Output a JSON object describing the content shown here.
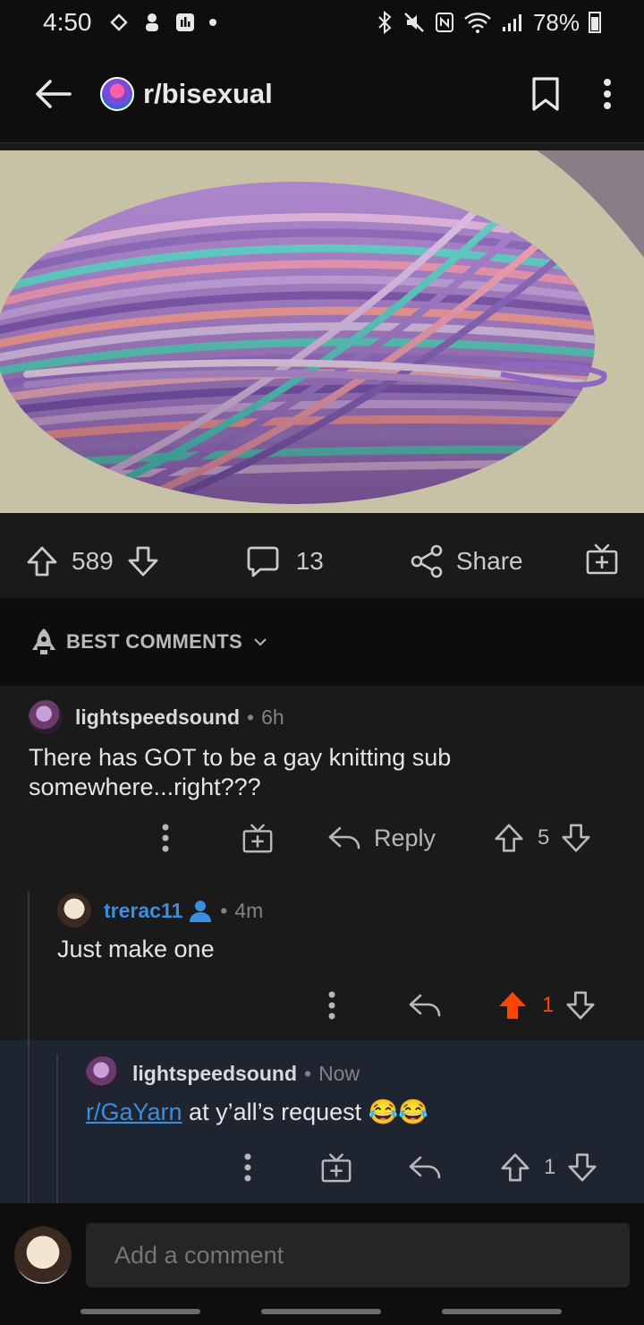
{
  "status_bar": {
    "time": "4:50",
    "battery": "78%",
    "left_icons": [
      "link-icon",
      "hand-icon",
      "app-icon",
      "dot-icon"
    ],
    "right_icons": [
      "bluetooth-icon",
      "mute-icon",
      "nfc-icon",
      "wifi-icon",
      "signal-icon",
      "battery-icon"
    ]
  },
  "header": {
    "subreddit": "r/bisexual",
    "icons": [
      "back-arrow-icon",
      "bookmark-icon",
      "more-vertical-icon"
    ]
  },
  "post": {
    "image_icon": "yarn-ball-image",
    "upvotes": "589",
    "comments": "13",
    "share_label": "Share"
  },
  "sort": {
    "label": "BEST COMMENTS"
  },
  "comments": [
    {
      "author": "lightspeedsound",
      "age": "6h",
      "body": "There has GOT to be a gay knitting sub somewhere...right???",
      "reply_label": "Reply",
      "score": "5"
    },
    {
      "author": "trerac11",
      "age": "4m",
      "body": "Just make one",
      "score": "1",
      "upvoted": true
    },
    {
      "author": "lightspeedsound",
      "age": "Now",
      "link_text": "r/GaYarn",
      "body_rest": " at y’all’s request 😂😂",
      "score": "1"
    }
  ],
  "composer": {
    "placeholder": "Add a comment"
  },
  "colors": {
    "background": "#1a1a1b",
    "upvote_active": "#ff4500",
    "link": "#3b8dde",
    "highlight": "#1f2530"
  }
}
